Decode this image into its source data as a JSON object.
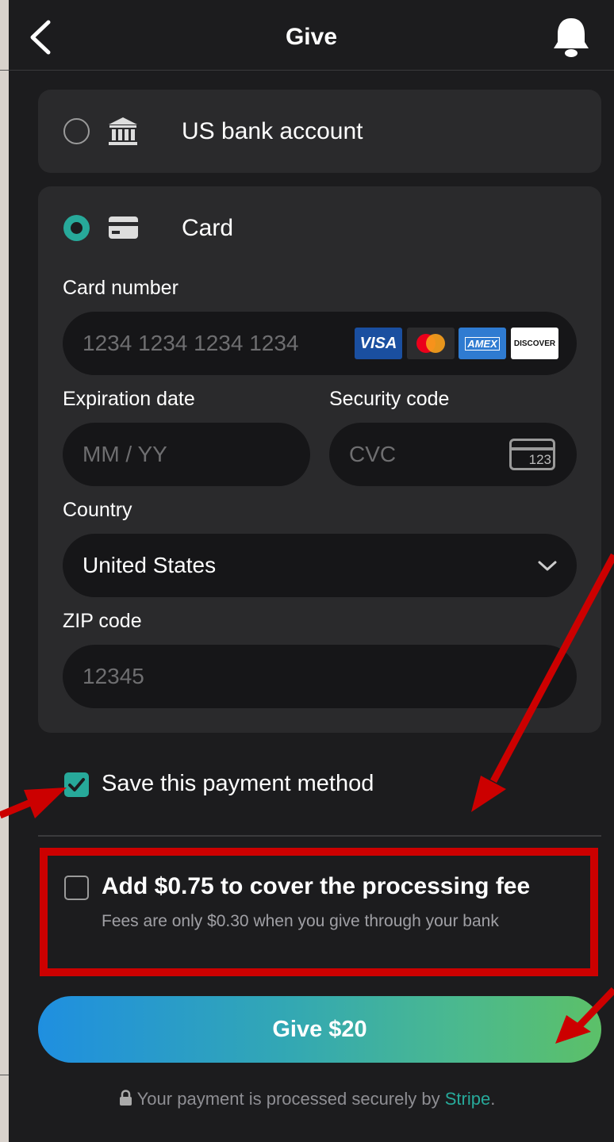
{
  "header": {
    "title": "Give"
  },
  "payment_options": {
    "bank": {
      "label": "US bank account"
    },
    "card": {
      "label": "Card"
    }
  },
  "card_form": {
    "card_number_label": "Card number",
    "card_number_placeholder": "1234 1234 1234 1234",
    "card_brands": [
      "VISA",
      "mastercard",
      "AMEX",
      "DISCOVER"
    ],
    "expiration_label": "Expiration date",
    "expiration_placeholder": "MM / YY",
    "security_label": "Security code",
    "security_placeholder": "CVC",
    "cvc_icon_text": "123",
    "country_label": "Country",
    "country_value": "United States",
    "zip_label": "ZIP code",
    "zip_placeholder": "12345"
  },
  "save_method": {
    "label": "Save this payment method",
    "checked": true
  },
  "fee_option": {
    "title": "Add $0.75 to cover the processing fee",
    "subtitle": "Fees are only $0.30 when you give through your bank",
    "checked": false
  },
  "give_button": {
    "label": "Give $20"
  },
  "footer": {
    "text": "Your payment is processed securely by",
    "link": "Stripe",
    "suffix": "."
  },
  "colors": {
    "accent": "#27a99a",
    "annotation": "#cc0000",
    "background": "#1c1c1e",
    "panel": "#2a2a2c"
  }
}
